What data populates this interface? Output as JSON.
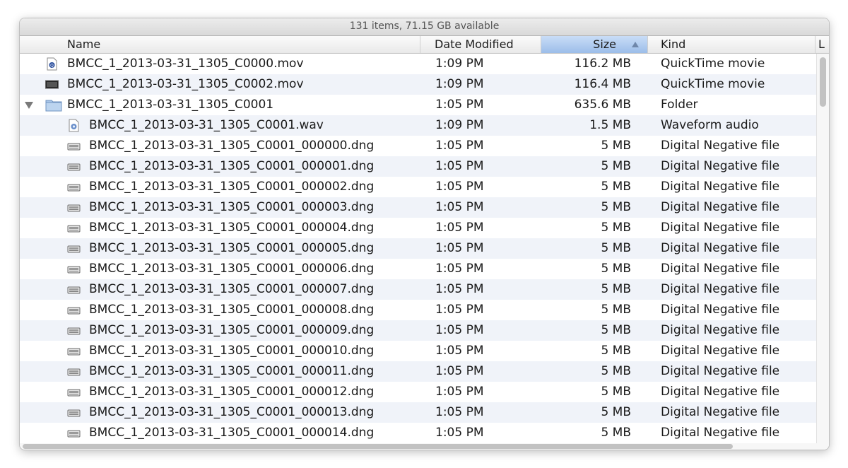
{
  "status_bar": {
    "text": "131 items, 71.15 GB available"
  },
  "columns": {
    "name": "Name",
    "date": "Date Modified",
    "size": "Size",
    "kind": "Kind",
    "extra": "L"
  },
  "rows": [
    {
      "name": "BMCC_1_2013-03-31_1305_C0000.mov",
      "date": "1:09 PM",
      "size": "116.2 MB",
      "kind": "QuickTime movie",
      "icon": "quicktime-icon",
      "indent": 0
    },
    {
      "name": "BMCC_1_2013-03-31_1305_C0002.mov",
      "date": "1:09 PM",
      "size": "116.4 MB",
      "kind": "QuickTime movie",
      "icon": "video-thumbnail-icon",
      "indent": 0
    },
    {
      "name": "BMCC_1_2013-03-31_1305_C0001",
      "date": "1:05 PM",
      "size": "635.6 MB",
      "kind": "Folder",
      "icon": "folder-icon",
      "indent": 0,
      "expanded": true
    },
    {
      "name": "BMCC_1_2013-03-31_1305_C0001.wav",
      "date": "1:09 PM",
      "size": "1.5 MB",
      "kind": "Waveform audio",
      "icon": "audio-file-icon",
      "indent": 1
    },
    {
      "name": "BMCC_1_2013-03-31_1305_C0001_000000.dng",
      "date": "1:05 PM",
      "size": "5 MB",
      "kind": "Digital Negative file",
      "icon": "dng-file-icon",
      "indent": 1
    },
    {
      "name": "BMCC_1_2013-03-31_1305_C0001_000001.dng",
      "date": "1:05 PM",
      "size": "5 MB",
      "kind": "Digital Negative file",
      "icon": "dng-file-icon",
      "indent": 1
    },
    {
      "name": "BMCC_1_2013-03-31_1305_C0001_000002.dng",
      "date": "1:05 PM",
      "size": "5 MB",
      "kind": "Digital Negative file",
      "icon": "dng-file-icon",
      "indent": 1
    },
    {
      "name": "BMCC_1_2013-03-31_1305_C0001_000003.dng",
      "date": "1:05 PM",
      "size": "5 MB",
      "kind": "Digital Negative file",
      "icon": "dng-file-icon",
      "indent": 1
    },
    {
      "name": "BMCC_1_2013-03-31_1305_C0001_000004.dng",
      "date": "1:05 PM",
      "size": "5 MB",
      "kind": "Digital Negative file",
      "icon": "dng-file-icon",
      "indent": 1
    },
    {
      "name": "BMCC_1_2013-03-31_1305_C0001_000005.dng",
      "date": "1:05 PM",
      "size": "5 MB",
      "kind": "Digital Negative file",
      "icon": "dng-file-icon",
      "indent": 1
    },
    {
      "name": "BMCC_1_2013-03-31_1305_C0001_000006.dng",
      "date": "1:05 PM",
      "size": "5 MB",
      "kind": "Digital Negative file",
      "icon": "dng-file-icon",
      "indent": 1
    },
    {
      "name": "BMCC_1_2013-03-31_1305_C0001_000007.dng",
      "date": "1:05 PM",
      "size": "5 MB",
      "kind": "Digital Negative file",
      "icon": "dng-file-icon",
      "indent": 1
    },
    {
      "name": "BMCC_1_2013-03-31_1305_C0001_000008.dng",
      "date": "1:05 PM",
      "size": "5 MB",
      "kind": "Digital Negative file",
      "icon": "dng-file-icon",
      "indent": 1
    },
    {
      "name": "BMCC_1_2013-03-31_1305_C0001_000009.dng",
      "date": "1:05 PM",
      "size": "5 MB",
      "kind": "Digital Negative file",
      "icon": "dng-file-icon",
      "indent": 1
    },
    {
      "name": "BMCC_1_2013-03-31_1305_C0001_000010.dng",
      "date": "1:05 PM",
      "size": "5 MB",
      "kind": "Digital Negative file",
      "icon": "dng-file-icon",
      "indent": 1
    },
    {
      "name": "BMCC_1_2013-03-31_1305_C0001_000011.dng",
      "date": "1:05 PM",
      "size": "5 MB",
      "kind": "Digital Negative file",
      "icon": "dng-file-icon",
      "indent": 1
    },
    {
      "name": "BMCC_1_2013-03-31_1305_C0001_000012.dng",
      "date": "1:05 PM",
      "size": "5 MB",
      "kind": "Digital Negative file",
      "icon": "dng-file-icon",
      "indent": 1
    },
    {
      "name": "BMCC_1_2013-03-31_1305_C0001_000013.dng",
      "date": "1:05 PM",
      "size": "5 MB",
      "kind": "Digital Negative file",
      "icon": "dng-file-icon",
      "indent": 1
    },
    {
      "name": "BMCC_1_2013-03-31_1305_C0001_000014.dng",
      "date": "1:05 PM",
      "size": "5 MB",
      "kind": "Digital Negative file",
      "icon": "dng-file-icon",
      "indent": 1
    }
  ],
  "colors": {
    "row_stripe": "#f0f3f9",
    "sorted_header": "#b6cff1",
    "sort_arrow": "#6f87aa"
  }
}
